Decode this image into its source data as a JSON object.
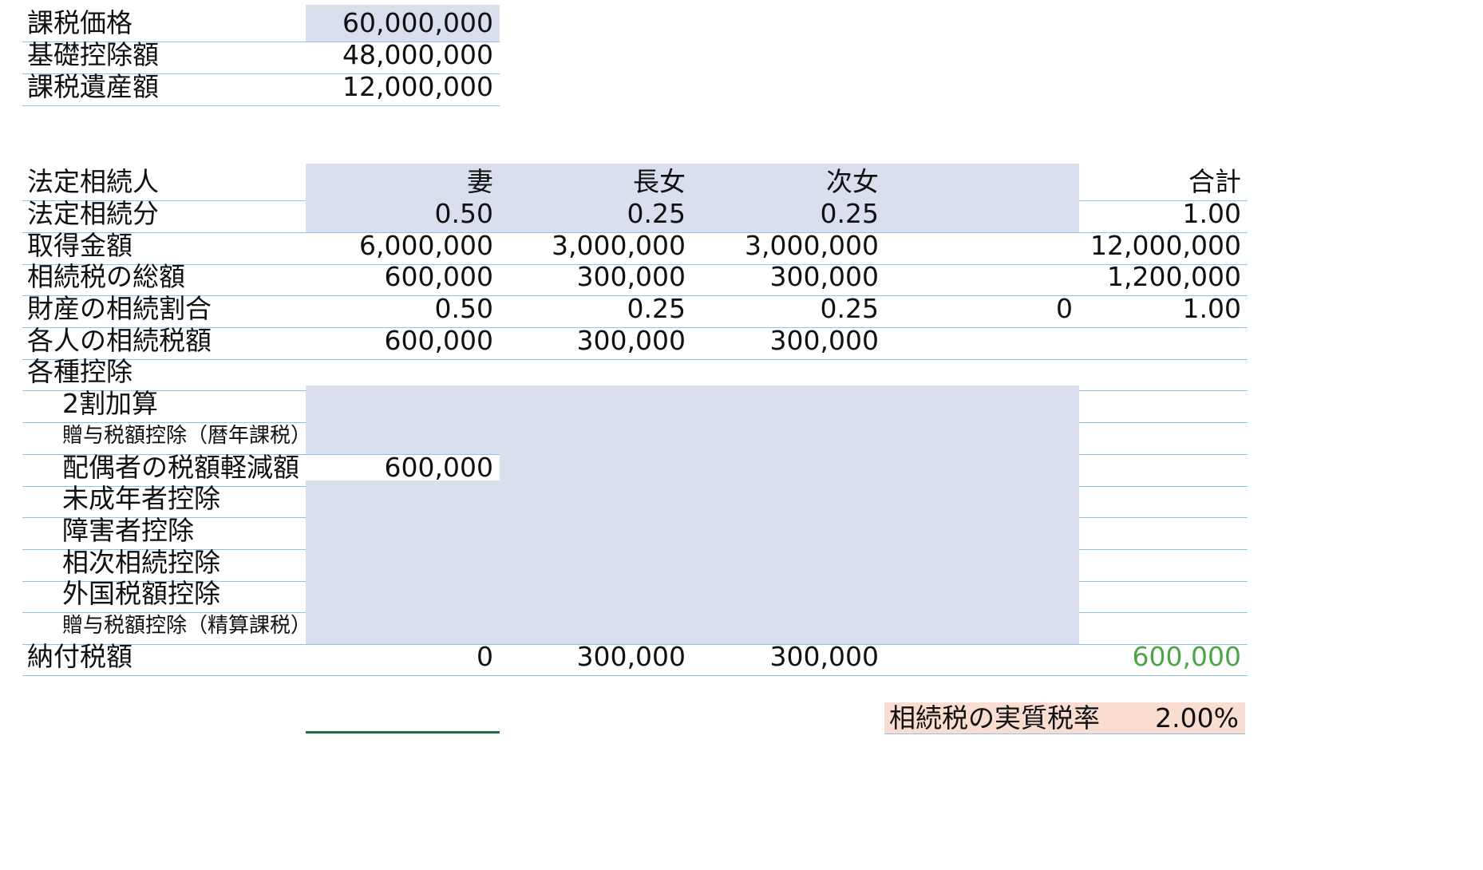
{
  "summary": {
    "rows": [
      {
        "label": "課税価格",
        "value": "60,000,000"
      },
      {
        "label": "基礎控除額",
        "value": "48,000,000"
      },
      {
        "label": "課税遺産額",
        "value": "12,000,000"
      }
    ]
  },
  "table": {
    "header": {
      "label": "法定相続人",
      "wife": "妻",
      "eldest": "長女",
      "second": "次女",
      "extra": "",
      "total": "合計"
    },
    "rows": [
      {
        "label": "法定相続分",
        "wife": "0.50",
        "eldest": "0.25",
        "second": "0.25",
        "extra": "",
        "total": "1.00"
      },
      {
        "label": "取得金額",
        "wife": "6,000,000",
        "eldest": "3,000,000",
        "second": "3,000,000",
        "extra": "",
        "total": "12,000,000"
      },
      {
        "label": "相続税の総額",
        "wife": "600,000",
        "eldest": "300,000",
        "second": "300,000",
        "extra": "",
        "total": "1,200,000"
      },
      {
        "label": "財産の相続割合",
        "wife": "0.50",
        "eldest": "0.25",
        "second": "0.25",
        "extra": "0",
        "total": "1.00"
      },
      {
        "label": "各人の相続税額",
        "wife": "600,000",
        "eldest": "300,000",
        "second": "300,000",
        "extra": "",
        "total": ""
      },
      {
        "label": "各種控除",
        "wife": "",
        "eldest": "",
        "second": "",
        "extra": "",
        "total": ""
      }
    ],
    "deductions": [
      {
        "label": "2割加算",
        "wife": ""
      },
      {
        "label": "贈与税額控除（暦年課税）",
        "wife": ""
      },
      {
        "label": "配偶者の税額軽減額",
        "wife": "600,000"
      },
      {
        "label": "未成年者控除",
        "wife": ""
      },
      {
        "label": "障害者控除",
        "wife": ""
      },
      {
        "label": "相次相続控除",
        "wife": ""
      },
      {
        "label": "外国税額控除",
        "wife": ""
      },
      {
        "label": "贈与税額控除（精算課税）",
        "wife": ""
      }
    ],
    "payable": {
      "label": "納付税額",
      "wife": "0",
      "eldest": "300,000",
      "second": "300,000",
      "extra": "",
      "total": "600,000"
    }
  },
  "effective_rate": {
    "label": "相続税の実質税率",
    "value": "2.00%"
  },
  "colors": {
    "input_fill": "#dadfee",
    "rate_fill": "#f8ddd0",
    "total_green": "#4ca548",
    "border": "#8ec3e6"
  }
}
